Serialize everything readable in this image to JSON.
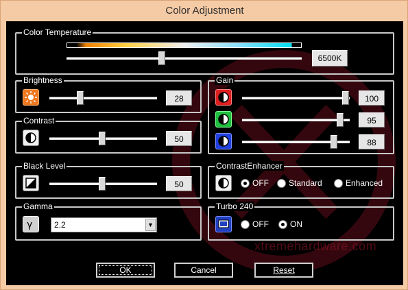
{
  "window": {
    "title": "Color Adjustment"
  },
  "color_temperature": {
    "label": "Color Temperature",
    "value": "6500K"
  },
  "brightness": {
    "label": "Brightness",
    "value": "28"
  },
  "contrast": {
    "label": "Contrast",
    "value": "50"
  },
  "black_level": {
    "label": "Black Level",
    "value": "50"
  },
  "gamma": {
    "label": "Gamma",
    "selected": "2.2"
  },
  "gain": {
    "label": "Gain",
    "red": "100",
    "green": "95",
    "blue": "88"
  },
  "contrast_enhancer": {
    "label": "ContrastEnhancer",
    "options": [
      "OFF",
      "Standard",
      "Enhanced"
    ],
    "selected": "OFF"
  },
  "turbo": {
    "label": "Turbo 240",
    "options": [
      "OFF",
      "ON"
    ],
    "selected": "ON"
  },
  "buttons": {
    "ok": "OK",
    "cancel": "Cancel",
    "reset": "Reset"
  },
  "watermark": "xtremehardware.com",
  "colors": {
    "gain_red": "#e02020",
    "gain_green": "#20c040",
    "gain_blue": "#2040e0",
    "icon_orange": "#f07820"
  }
}
